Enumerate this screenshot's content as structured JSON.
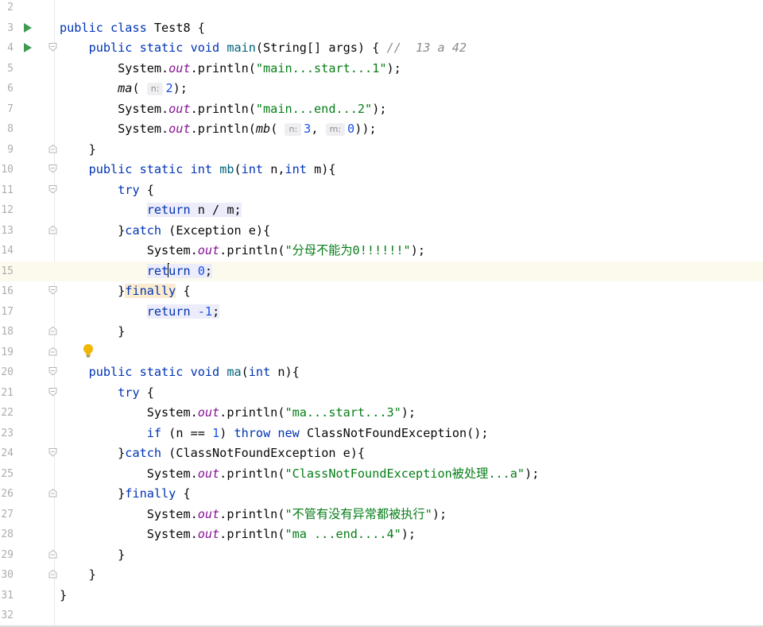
{
  "editor": {
    "lines": [
      {
        "n": "2",
        "segments": []
      },
      {
        "n": "3",
        "run": true,
        "segments": [
          {
            "t": "public ",
            "c": "kw"
          },
          {
            "t": "class ",
            "c": "kw"
          },
          {
            "t": "Test8 {"
          }
        ]
      },
      {
        "n": "4",
        "run": true,
        "fold": "open",
        "segments": [
          {
            "t": "    "
          },
          {
            "t": "public ",
            "c": "kw"
          },
          {
            "t": "static ",
            "c": "kw"
          },
          {
            "t": "void ",
            "c": "kw"
          },
          {
            "t": "main",
            "c": "mth"
          },
          {
            "t": "(String[] args) { "
          },
          {
            "t": "//  13 a 42",
            "c": "cmt"
          }
        ]
      },
      {
        "n": "5",
        "segments": [
          {
            "t": "        System."
          },
          {
            "t": "out",
            "c": "fld"
          },
          {
            "t": ".println("
          },
          {
            "t": "\"main...start...1\"",
            "c": "str"
          },
          {
            "t": ");"
          }
        ]
      },
      {
        "n": "6",
        "segments": [
          {
            "t": "        "
          },
          {
            "t": "ma",
            "c": "ital"
          },
          {
            "t": "( "
          },
          {
            "t": "n:",
            "c": "hint"
          },
          {
            "t": "2",
            "c": "num"
          },
          {
            "t": ");"
          }
        ]
      },
      {
        "n": "7",
        "segments": [
          {
            "t": "        System."
          },
          {
            "t": "out",
            "c": "fld"
          },
          {
            "t": ".println("
          },
          {
            "t": "\"main...end...2\"",
            "c": "str"
          },
          {
            "t": ");"
          }
        ]
      },
      {
        "n": "8",
        "segments": [
          {
            "t": "        System."
          },
          {
            "t": "out",
            "c": "fld"
          },
          {
            "t": ".println("
          },
          {
            "t": "mb",
            "c": "ital"
          },
          {
            "t": "( "
          },
          {
            "t": "n:",
            "c": "hint"
          },
          {
            "t": "3",
            "c": "num"
          },
          {
            "t": ", "
          },
          {
            "t": "m:",
            "c": "hint"
          },
          {
            "t": "0",
            "c": "num"
          },
          {
            "t": "));"
          }
        ]
      },
      {
        "n": "9",
        "fold": "close",
        "segments": [
          {
            "t": "    }"
          }
        ]
      },
      {
        "n": "10",
        "fold": "open",
        "segments": [
          {
            "t": "    "
          },
          {
            "t": "public ",
            "c": "kw"
          },
          {
            "t": "static ",
            "c": "kw"
          },
          {
            "t": "int ",
            "c": "kw"
          },
          {
            "t": "mb",
            "c": "mth"
          },
          {
            "t": "("
          },
          {
            "t": "int ",
            "c": "kw"
          },
          {
            "t": "n,"
          },
          {
            "t": "int ",
            "c": "kw"
          },
          {
            "t": "m){"
          }
        ]
      },
      {
        "n": "11",
        "fold": "open",
        "segments": [
          {
            "t": "        "
          },
          {
            "t": "try ",
            "c": "kw"
          },
          {
            "t": "{"
          }
        ]
      },
      {
        "n": "12",
        "segments": [
          {
            "t": "            "
          },
          {
            "t": "return",
            "c": "kw hl"
          },
          {
            "t": " n / m;",
            "c": "hl"
          }
        ]
      },
      {
        "n": "13",
        "fold": "close",
        "segments": [
          {
            "t": "        }"
          },
          {
            "t": "catch ",
            "c": "kw"
          },
          {
            "t": "(Exception e){"
          }
        ]
      },
      {
        "n": "14",
        "segments": [
          {
            "t": "            System."
          },
          {
            "t": "out",
            "c": "fld"
          },
          {
            "t": ".println("
          },
          {
            "t": "\"分母不能为0!!!!!!\"",
            "c": "str"
          },
          {
            "t": ");"
          }
        ]
      },
      {
        "n": "15",
        "current": true,
        "segments": [
          {
            "t": "            "
          },
          {
            "t": "ret",
            "c": "kw hl"
          },
          {
            "t": "",
            "c": "caret"
          },
          {
            "t": "urn",
            "c": "kw hl"
          },
          {
            "t": " ",
            "c": "hl"
          },
          {
            "t": "0",
            "c": "num hl"
          },
          {
            "t": ";",
            "c": "hl"
          }
        ]
      },
      {
        "n": "16",
        "fold": "open",
        "segments": [
          {
            "t": "        }"
          },
          {
            "t": "finally",
            "c": "kw hl-y"
          },
          {
            "t": " {"
          }
        ]
      },
      {
        "n": "17",
        "segments": [
          {
            "t": "            "
          },
          {
            "t": "return",
            "c": "kw hl"
          },
          {
            "t": " ",
            "c": "hl"
          },
          {
            "t": "-1",
            "c": "num hl"
          },
          {
            "t": ";",
            "c": "hl"
          }
        ]
      },
      {
        "n": "18",
        "fold": "close",
        "segments": [
          {
            "t": "        }"
          }
        ]
      },
      {
        "n": "19",
        "fold": "close",
        "segments": []
      },
      {
        "n": "20",
        "fold": "open",
        "segments": [
          {
            "t": "    "
          },
          {
            "t": "public ",
            "c": "kw"
          },
          {
            "t": "static ",
            "c": "kw"
          },
          {
            "t": "void ",
            "c": "kw"
          },
          {
            "t": "ma",
            "c": "mth"
          },
          {
            "t": "("
          },
          {
            "t": "int ",
            "c": "kw"
          },
          {
            "t": "n){"
          }
        ]
      },
      {
        "n": "21",
        "fold": "open",
        "segments": [
          {
            "t": "        "
          },
          {
            "t": "try ",
            "c": "kw"
          },
          {
            "t": "{"
          }
        ]
      },
      {
        "n": "22",
        "segments": [
          {
            "t": "            System."
          },
          {
            "t": "out",
            "c": "fld"
          },
          {
            "t": ".println("
          },
          {
            "t": "\"ma...start...3\"",
            "c": "str"
          },
          {
            "t": ");"
          }
        ]
      },
      {
        "n": "23",
        "segments": [
          {
            "t": "            "
          },
          {
            "t": "if ",
            "c": "kw"
          },
          {
            "t": "(n == "
          },
          {
            "t": "1",
            "c": "num"
          },
          {
            "t": ") "
          },
          {
            "t": "throw ",
            "c": "kw"
          },
          {
            "t": "new ",
            "c": "kw"
          },
          {
            "t": "ClassNotFoundException();"
          }
        ]
      },
      {
        "n": "24",
        "fold": "open",
        "segments": [
          {
            "t": "        }"
          },
          {
            "t": "catch ",
            "c": "kw"
          },
          {
            "t": "(ClassNotFoundException e){"
          }
        ]
      },
      {
        "n": "25",
        "segments": [
          {
            "t": "            System."
          },
          {
            "t": "out",
            "c": "fld"
          },
          {
            "t": ".println("
          },
          {
            "t": "\"ClassNotFoundException被处理...a\"",
            "c": "str"
          },
          {
            "t": ");"
          }
        ]
      },
      {
        "n": "26",
        "fold": "close",
        "segments": [
          {
            "t": "        }"
          },
          {
            "t": "finally ",
            "c": "kw"
          },
          {
            "t": "{"
          }
        ]
      },
      {
        "n": "27",
        "segments": [
          {
            "t": "            System."
          },
          {
            "t": "out",
            "c": "fld"
          },
          {
            "t": ".println("
          },
          {
            "t": "\"不管有没有异常都被执行\"",
            "c": "str"
          },
          {
            "t": ");"
          }
        ]
      },
      {
        "n": "28",
        "segments": [
          {
            "t": "            System."
          },
          {
            "t": "out",
            "c": "fld"
          },
          {
            "t": ".println("
          },
          {
            "t": "\"ma ...end....4\"",
            "c": "str"
          },
          {
            "t": ");"
          }
        ]
      },
      {
        "n": "29",
        "fold": "close",
        "segments": [
          {
            "t": "        }"
          }
        ]
      },
      {
        "n": "30",
        "fold": "close",
        "segments": [
          {
            "t": "    }"
          }
        ]
      },
      {
        "n": "31",
        "segments": [
          {
            "t": "}"
          }
        ]
      },
      {
        "n": "32",
        "segments": []
      }
    ]
  },
  "icons": {
    "run": "run-gutter-icon",
    "fold": "fold-marker-icon",
    "intention": "lightbulb-icon"
  },
  "colors": {
    "keyword": "#0033b3",
    "string": "#067d17",
    "number": "#1750eb",
    "field": "#871094",
    "run_arrow": "#3f9b52",
    "current_line": "#fcfaed"
  }
}
